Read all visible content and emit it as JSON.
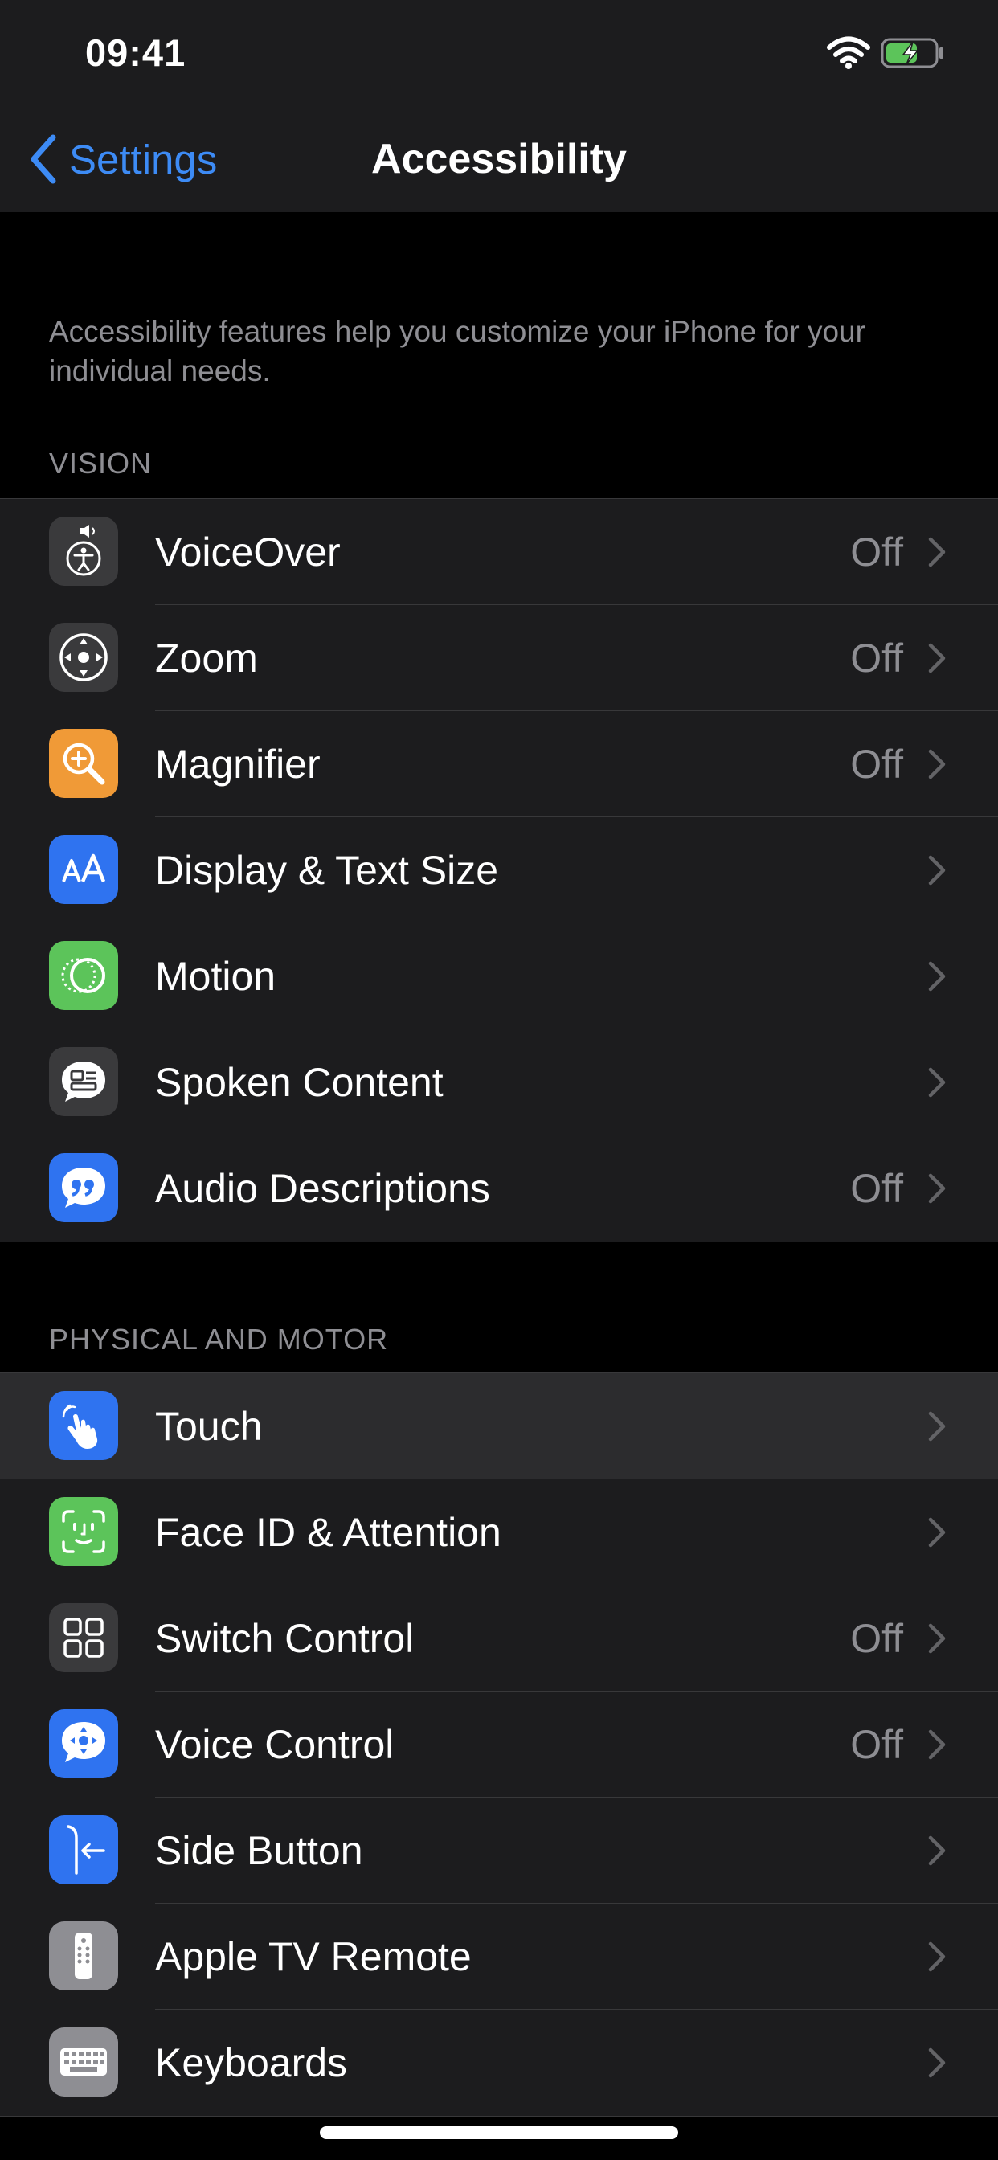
{
  "status_bar": {
    "time": "09:41"
  },
  "nav": {
    "back_label": "Settings",
    "title": "Accessibility"
  },
  "intro": "Accessibility features help you customize your iPhone for your individual needs.",
  "colors": {
    "accent": "#3d8bf5",
    "background": "#000000",
    "cell": "#1c1c1e",
    "secondary_text": "#8e8e93"
  },
  "sections": [
    {
      "header": "VISION",
      "items": [
        {
          "label": "VoiceOver",
          "value": "Off",
          "icon": "voiceover-icon",
          "icon_color": "#3a3a3c"
        },
        {
          "label": "Zoom",
          "value": "Off",
          "icon": "zoom-icon",
          "icon_color": "#3a3a3c"
        },
        {
          "label": "Magnifier",
          "value": "Off",
          "icon": "magnifier-icon",
          "icon_color": "#f09a37"
        },
        {
          "label": "Display & Text Size",
          "value": "",
          "icon": "text-size-icon",
          "icon_color": "#2f73f0"
        },
        {
          "label": "Motion",
          "value": "",
          "icon": "motion-icon",
          "icon_color": "#5cc45a"
        },
        {
          "label": "Spoken Content",
          "value": "",
          "icon": "spoken-content-icon",
          "icon_color": "#3a3a3c"
        },
        {
          "label": "Audio Descriptions",
          "value": "Off",
          "icon": "audio-descriptions-icon",
          "icon_color": "#2f73f0"
        }
      ]
    },
    {
      "header": "PHYSICAL AND MOTOR",
      "items": [
        {
          "label": "Touch",
          "value": "",
          "icon": "touch-icon",
          "icon_color": "#2f73f0",
          "highlighted": true
        },
        {
          "label": "Face ID & Attention",
          "value": "",
          "icon": "face-id-icon",
          "icon_color": "#5cc45a"
        },
        {
          "label": "Switch Control",
          "value": "Off",
          "icon": "switch-control-icon",
          "icon_color": "#3a3a3c"
        },
        {
          "label": "Voice Control",
          "value": "Off",
          "icon": "voice-control-icon",
          "icon_color": "#2f73f0"
        },
        {
          "label": "Side Button",
          "value": "",
          "icon": "side-button-icon",
          "icon_color": "#2f73f0"
        },
        {
          "label": "Apple TV Remote",
          "value": "",
          "icon": "apple-tv-remote-icon",
          "icon_color": "#8e8e93"
        },
        {
          "label": "Keyboards",
          "value": "",
          "icon": "keyboard-icon",
          "icon_color": "#8e8e93"
        }
      ]
    }
  ]
}
